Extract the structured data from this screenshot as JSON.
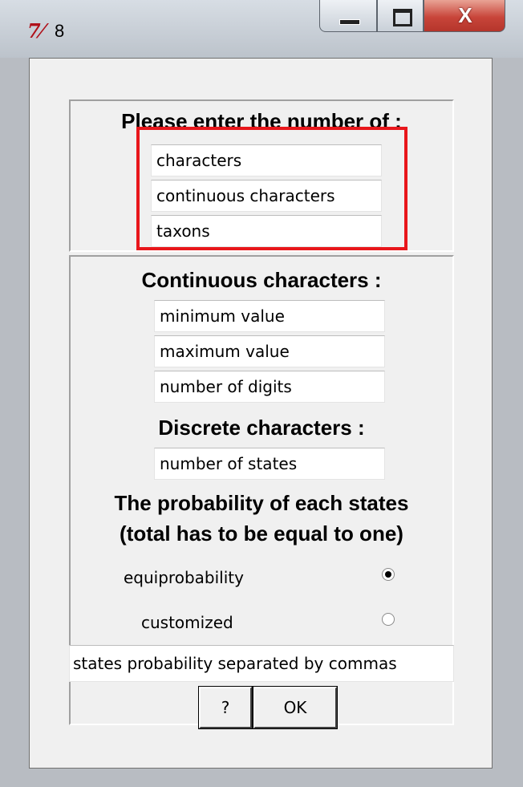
{
  "window": {
    "title": "8",
    "icon": "tk-feather-icon",
    "close_label": "X"
  },
  "section_count": {
    "heading": "Please enter the number of :",
    "fields": [
      {
        "placeholder": "characters"
      },
      {
        "placeholder": "continuous characters"
      },
      {
        "placeholder": "taxons"
      }
    ]
  },
  "continuous": {
    "heading": "Continuous characters :",
    "fields": [
      {
        "placeholder": "minimum value"
      },
      {
        "placeholder": "maximum value"
      },
      {
        "placeholder": "number of digits"
      }
    ]
  },
  "discrete": {
    "heading": "Discrete characters :",
    "field": {
      "placeholder": "number of states"
    }
  },
  "probability": {
    "heading_line1": "The probability of each states",
    "heading_line2": "(total has to be equal to one)",
    "options": [
      {
        "label": "equiprobability",
        "selected": true
      },
      {
        "label": "customized",
        "selected": false
      }
    ],
    "custom_field": {
      "placeholder": "states probability separated by commas"
    }
  },
  "buttons": {
    "help": "?",
    "ok": "OK"
  },
  "colors": {
    "highlight": "#e8161b",
    "close_button": "#c8453a",
    "dialog_bg": "#f0f0f0"
  }
}
